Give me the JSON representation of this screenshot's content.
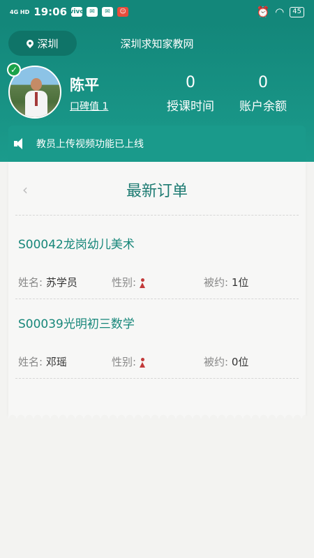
{
  "status_bar": {
    "network": "4G HD",
    "time": "19:06",
    "notifications": [
      "vivo",
      "✉",
      "✉",
      "☺"
    ],
    "battery": "45"
  },
  "header": {
    "city": "深圳",
    "site_title": "深圳求知家教网",
    "user_name": "陈平",
    "rating_label": "口碑值 1",
    "teaching_time_value": "0",
    "teaching_time_label": "授课时间",
    "balance_value": "0",
    "balance_label": "账户余额"
  },
  "notice": {
    "text": "教员上传视频功能已上线"
  },
  "orders_card": {
    "back_glyph": "‹",
    "title": "最新订单",
    "orders": [
      {
        "title": "S00042龙岗幼儿美术",
        "name_label": "姓名:",
        "name": "苏学员",
        "gender_label": "性别:",
        "booked_label": "被约:",
        "booked": "1位"
      },
      {
        "title": "S00039光明初三数学",
        "name_label": "姓名:",
        "name": "邓瑶",
        "gender_label": "性别:",
        "booked_label": "被约:",
        "booked": "0位"
      }
    ]
  },
  "colors": {
    "primary": "#13877a",
    "accent_text": "#17877a",
    "female_icon": "#c23a3a"
  }
}
